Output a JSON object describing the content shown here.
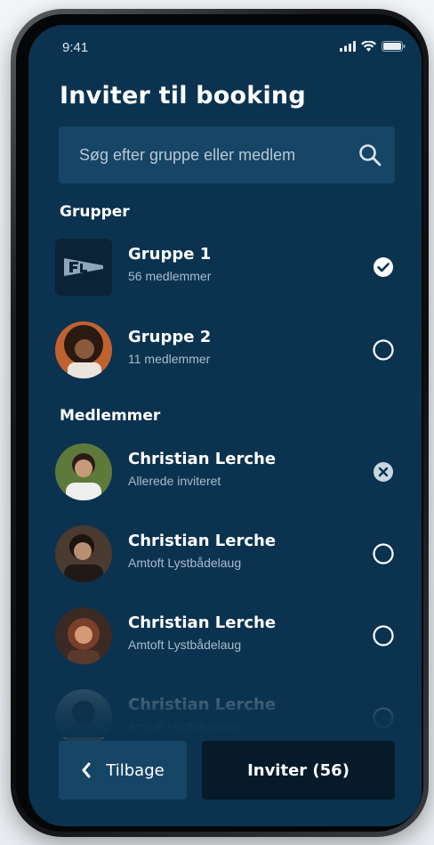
{
  "status_bar": {
    "time": "9:41"
  },
  "header": {
    "title": "Inviter til booking"
  },
  "search": {
    "placeholder": "Søg efter gruppe eller medlem",
    "value": ""
  },
  "groups": {
    "section_label": "Grupper",
    "items": [
      {
        "name": "Gruppe 1",
        "sub": "56 medlemmer",
        "state": "selected"
      },
      {
        "name": "Gruppe 2",
        "sub": "11 medlemmer",
        "state": "unselected"
      }
    ]
  },
  "members": {
    "section_label": "Medlemmer",
    "items": [
      {
        "name": "Christian Lerche",
        "sub": "Allerede inviteret",
        "state": "already-invited"
      },
      {
        "name": "Christian Lerche",
        "sub": "Amtoft Lystbådelaug",
        "state": "unselected"
      },
      {
        "name": "Christian Lerche",
        "sub": "Amtoft Lystbådelaug",
        "state": "unselected"
      },
      {
        "name": "Christian Lerche",
        "sub": "Amtoft Lystbådelaug",
        "state": "unselected"
      }
    ]
  },
  "footer": {
    "back_label": "Tilbage",
    "invite_label": "Inviter (56)"
  },
  "colors": {
    "background": "#0b3350",
    "surface": "#164566",
    "primary_button": "#061a2a",
    "text": "#ffffff",
    "muted_text": "#a9bccb"
  },
  "icons": [
    "signal-icon",
    "wifi-icon",
    "battery-icon",
    "search-icon",
    "check-circle-icon",
    "empty-circle-icon",
    "clear-circle-icon",
    "chevron-left-icon",
    "group-logo-icon"
  ]
}
